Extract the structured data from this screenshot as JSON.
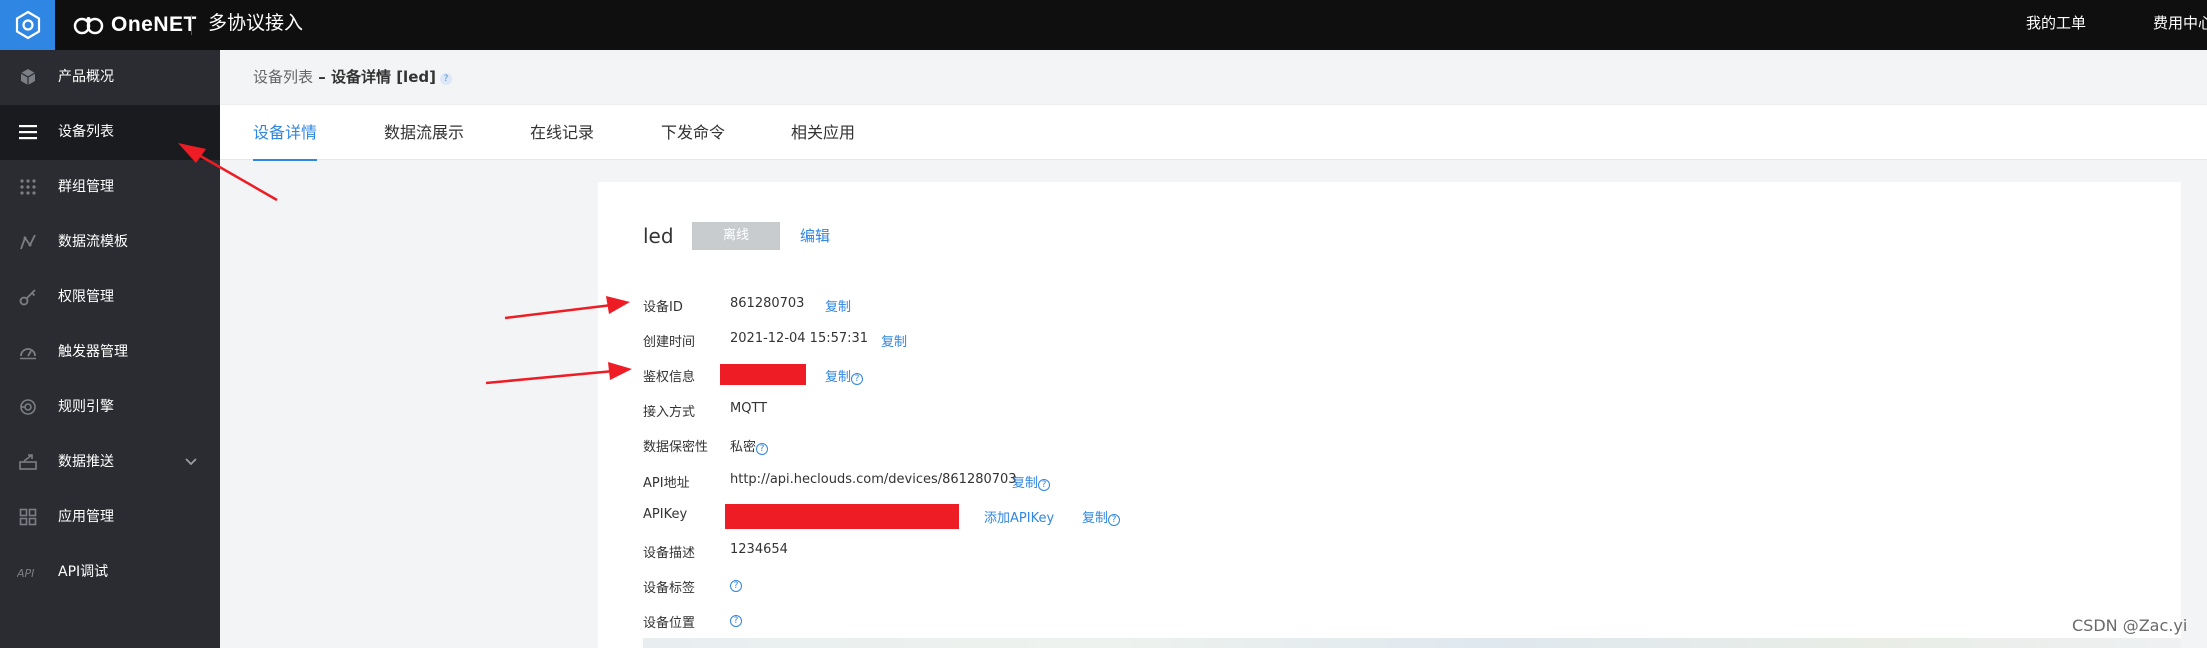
{
  "topbar": {
    "brand": "OneNET",
    "app_name": "多协议接入",
    "my_tickets": "我的工单",
    "billing": "费用中心"
  },
  "sidebar": {
    "items": [
      {
        "label": "产品概况",
        "icon": "cube-icon"
      },
      {
        "label": "设备列表",
        "icon": "list-icon",
        "active": true
      },
      {
        "label": "群组管理",
        "icon": "grid-dots-icon"
      },
      {
        "label": "数据流模板",
        "icon": "line-chart-icon"
      },
      {
        "label": "权限管理",
        "icon": "key-icon"
      },
      {
        "label": "触发器管理",
        "icon": "gauge-icon"
      },
      {
        "label": "规则引擎",
        "icon": "rule-icon"
      },
      {
        "label": "数据推送",
        "icon": "push-icon",
        "expandable": true
      },
      {
        "label": "应用管理",
        "icon": "apps-icon"
      },
      {
        "label": "API调试",
        "icon": "api-icon"
      }
    ]
  },
  "breadcrumb": {
    "parent": "设备列表",
    "separator": " – ",
    "current": "设备详情 [led]",
    "help": "?"
  },
  "tabs": [
    {
      "label": "设备详情",
      "active": true
    },
    {
      "label": "数据流展示"
    },
    {
      "label": "在线记录"
    },
    {
      "label": "下发命令"
    },
    {
      "label": "相关应用"
    }
  ],
  "device": {
    "name": "led",
    "status": "离线",
    "edit_label": "编辑"
  },
  "details": {
    "device_id_label": "设备ID",
    "device_id": "861280703",
    "created_label": "创建时间",
    "created": "2021-12-04 15:57:31",
    "auth_label": "鉴权信息",
    "access_label": "接入方式",
    "access": "MQTT",
    "privacy_label": "数据保密性",
    "privacy": "私密",
    "api_label": "API地址",
    "api": "http://api.heclouds.com/devices/861280703",
    "apikey_label": "APIKey",
    "add_apikey": "添加APIKey",
    "desc_label": "设备描述",
    "desc": "1234654",
    "tags_label": "设备标签",
    "location_label": "设备位置",
    "copy": "复制",
    "help": "?"
  },
  "watermark": "CSDN @Zac.yi",
  "colors": {
    "topbar": "#0f0f10",
    "sidebar": "#2a2c31",
    "accent": "#2f86e3",
    "annotation_red": "#ee1c25"
  }
}
